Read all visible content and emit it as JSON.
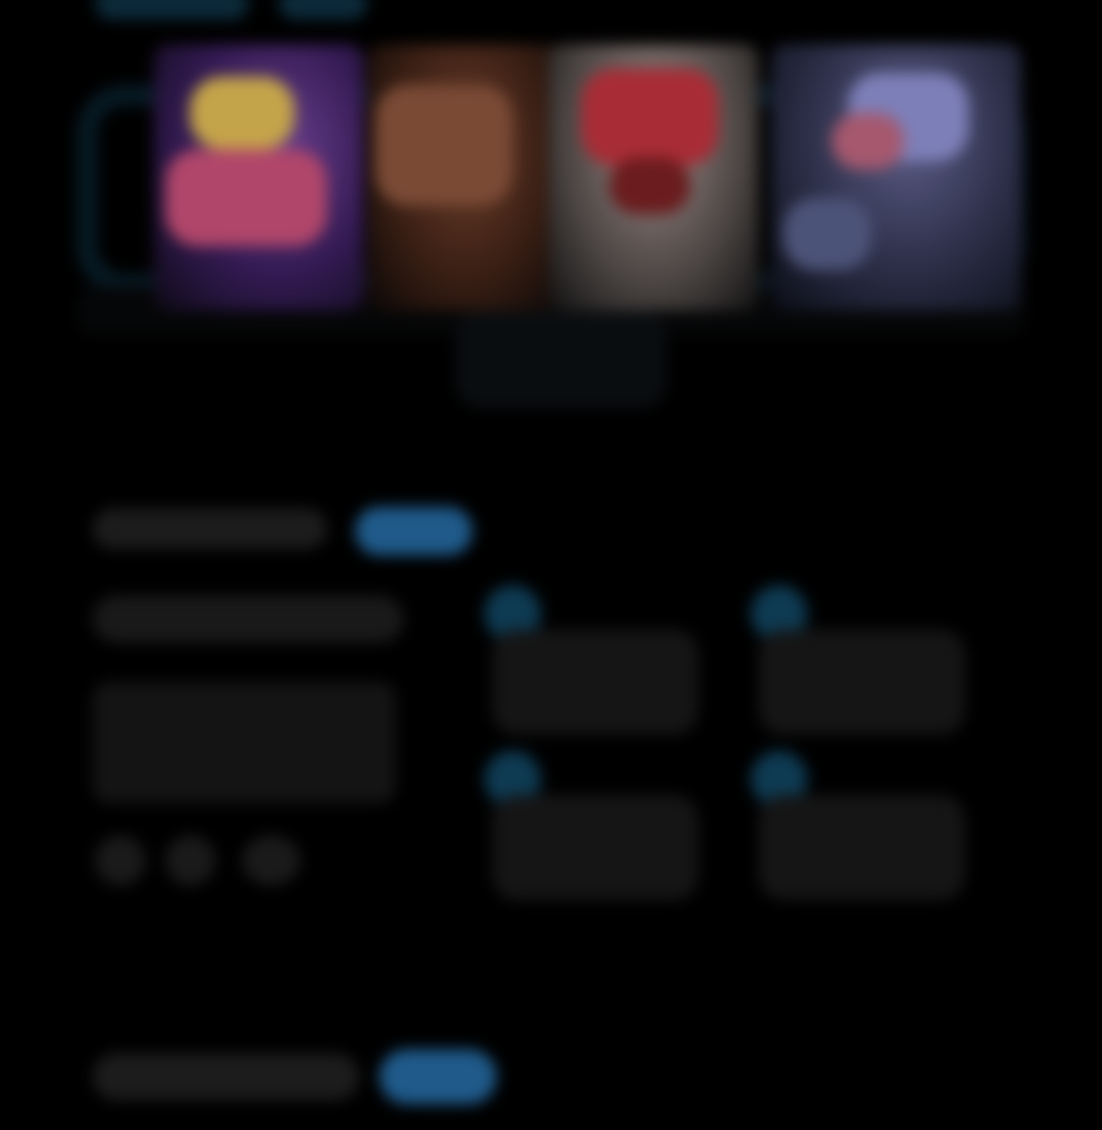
{
  "colors": {
    "background": "#000000",
    "accent": "#1f5a8a",
    "accent_dark": "#0e3a52",
    "panel": "#151515"
  },
  "top_nav": {
    "chips": [
      "",
      ""
    ]
  },
  "carousel": {
    "cards": [
      {
        "label": ""
      },
      {
        "label": ""
      },
      {
        "label": ""
      },
      {
        "label": ""
      }
    ],
    "caption": ""
  },
  "section1": {
    "input_placeholder": "",
    "button_label": "",
    "field_label": "",
    "form_text": "",
    "dots": 3
  },
  "tiles": [
    {
      "icon": "tile-icon",
      "text": ""
    },
    {
      "icon": "tile-icon",
      "text": ""
    },
    {
      "icon": "tile-icon",
      "text": ""
    },
    {
      "icon": "tile-icon",
      "text": ""
    }
  ],
  "footer": {
    "input_placeholder": "",
    "button_label": ""
  }
}
